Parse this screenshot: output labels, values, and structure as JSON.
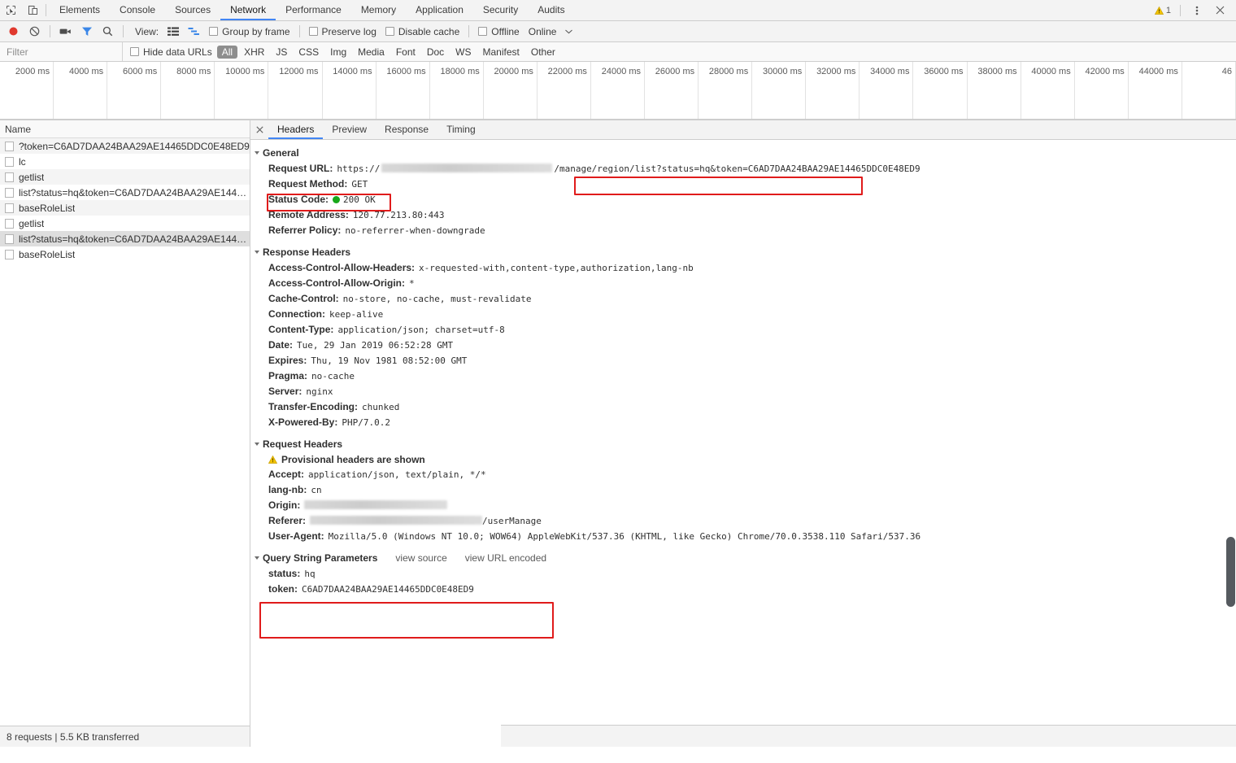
{
  "window": {
    "tabs": [
      {
        "label": "Elements",
        "selected": false
      },
      {
        "label": "Console",
        "selected": false
      },
      {
        "label": "Sources",
        "selected": false
      },
      {
        "label": "Network",
        "selected": true
      },
      {
        "label": "Performance",
        "selected": false
      },
      {
        "label": "Memory",
        "selected": false
      },
      {
        "label": "Application",
        "selected": false
      },
      {
        "label": "Security",
        "selected": false
      },
      {
        "label": "Audits",
        "selected": false
      }
    ],
    "warning_count": "1",
    "inspect_icon": "inspect-element-icon",
    "device_icon": "device-toolbar-icon",
    "more_icon": "more-options-icon",
    "close_icon": "close-icon"
  },
  "network_toolbar": {
    "record_icon": "record-stop-icon",
    "clear_icon": "clear-icon",
    "capture_screenshots_icon": "camera-icon",
    "filter_icon": "filter-funnel-icon",
    "search_icon": "search-icon",
    "view_label": "View:",
    "view_list_icon": "list-view-icon",
    "view_waterfall_icon": "waterfall-view-icon",
    "group_by_frame": "Group by frame",
    "preserve_log": "Preserve log",
    "disable_cache": "Disable cache",
    "offline": "Offline",
    "throttling_value": "Online",
    "throttling_caret_icon": "chevron-down-icon"
  },
  "filter_bar": {
    "placeholder": "Filter",
    "value": "",
    "hide_data_urls": "Hide data URLs",
    "types": [
      {
        "label": "All",
        "active": true
      },
      {
        "label": "XHR",
        "active": false
      },
      {
        "label": "JS",
        "active": false
      },
      {
        "label": "CSS",
        "active": false
      },
      {
        "label": "Img",
        "active": false
      },
      {
        "label": "Media",
        "active": false
      },
      {
        "label": "Font",
        "active": false
      },
      {
        "label": "Doc",
        "active": false
      },
      {
        "label": "WS",
        "active": false
      },
      {
        "label": "Manifest",
        "active": false
      },
      {
        "label": "Other",
        "active": false
      }
    ]
  },
  "overview": {
    "ticks": [
      "2000 ms",
      "4000 ms",
      "6000 ms",
      "8000 ms",
      "10000 ms",
      "12000 ms",
      "14000 ms",
      "16000 ms",
      "18000 ms",
      "20000 ms",
      "22000 ms",
      "24000 ms",
      "26000 ms",
      "28000 ms",
      "30000 ms",
      "32000 ms",
      "34000 ms",
      "36000 ms",
      "38000 ms",
      "40000 ms",
      "42000 ms",
      "44000 ms",
      "46"
    ]
  },
  "request_pane": {
    "column_header": "Name",
    "rows": [
      {
        "name": "?token=C6AD7DAA24BAA29AE14465DDC0E48ED9",
        "selected": false
      },
      {
        "name": "lc",
        "selected": false
      },
      {
        "name": "getlist",
        "selected": false
      },
      {
        "name": "list?status=hq&token=C6AD7DAA24BAA29AE1446...",
        "selected": false
      },
      {
        "name": "baseRoleList",
        "selected": false
      },
      {
        "name": "getlist",
        "selected": false
      },
      {
        "name": "list?status=hq&token=C6AD7DAA24BAA29AE1446...",
        "selected": true
      },
      {
        "name": "baseRoleList",
        "selected": false
      }
    ],
    "status_text": "8 requests  |  5.5 KB transferred"
  },
  "detail": {
    "tabs": [
      {
        "label": "Headers",
        "selected": true
      },
      {
        "label": "Preview",
        "selected": false
      },
      {
        "label": "Response",
        "selected": false
      },
      {
        "label": "Timing",
        "selected": false
      }
    ],
    "general": {
      "title": "General",
      "request_url_key": "Request URL:",
      "request_url_prefix": "https://",
      "request_url_path": "/manage/region/list",
      "request_url_query": "?status=hq&token=C6AD7DAA24BAA29AE14465DDC0E48ED9",
      "request_method_key": "Request Method:",
      "request_method_value": "GET",
      "status_code_key": "Status Code:",
      "status_code_value": "200 OK",
      "remote_address_key": "Remote Address:",
      "remote_address_value": "120.77.213.80:443",
      "referrer_policy_key": "Referrer Policy:",
      "referrer_policy_value": "no-referrer-when-downgrade"
    },
    "response_headers": {
      "title": "Response Headers",
      "rows": [
        {
          "key": "Access-Control-Allow-Headers:",
          "value": "x-requested-with,content-type,authorization,lang-nb"
        },
        {
          "key": "Access-Control-Allow-Origin:",
          "value": "*"
        },
        {
          "key": "Cache-Control:",
          "value": "no-store, no-cache, must-revalidate"
        },
        {
          "key": "Connection:",
          "value": "keep-alive"
        },
        {
          "key": "Content-Type:",
          "value": "application/json; charset=utf-8"
        },
        {
          "key": "Date:",
          "value": "Tue, 29 Jan 2019 06:52:28 GMT"
        },
        {
          "key": "Expires:",
          "value": "Thu, 19 Nov 1981 08:52:00 GMT"
        },
        {
          "key": "Pragma:",
          "value": "no-cache"
        },
        {
          "key": "Server:",
          "value": "nginx"
        },
        {
          "key": "Transfer-Encoding:",
          "value": "chunked"
        },
        {
          "key": "X-Powered-By:",
          "value": "PHP/7.0.2"
        }
      ]
    },
    "request_headers": {
      "title": "Request Headers",
      "provisional_notice": "Provisional headers are shown",
      "accept_key": "Accept:",
      "accept_value": "application/json, text/plain, */*",
      "lang_key": "lang-nb:",
      "lang_value": "cn",
      "origin_key": "Origin:",
      "origin_value": "",
      "referer_key": "Referer:",
      "referer_suffix": "/userManage",
      "user_agent_key": "User-Agent:",
      "user_agent_value": "Mozilla/5.0 (Windows NT 10.0; WOW64) AppleWebKit/537.36 (KHTML, like Gecko) Chrome/70.0.3538.110 Safari/537.36"
    },
    "query_string": {
      "title": "Query String Parameters",
      "view_source": "view source",
      "view_url_encoded": "view URL encoded",
      "params": [
        {
          "key": "status:",
          "value": "hq"
        },
        {
          "key": "token:",
          "value": "C6AD7DAA24BAA29AE14465DDC0E48ED9"
        }
      ]
    }
  },
  "colors": {
    "accent": "#4286f4",
    "annotation": "#e01b1b",
    "status_ok": "#17a81a",
    "warning": "#e8b400",
    "record": "#e0392e",
    "chip_active": "#8e8e8e"
  }
}
